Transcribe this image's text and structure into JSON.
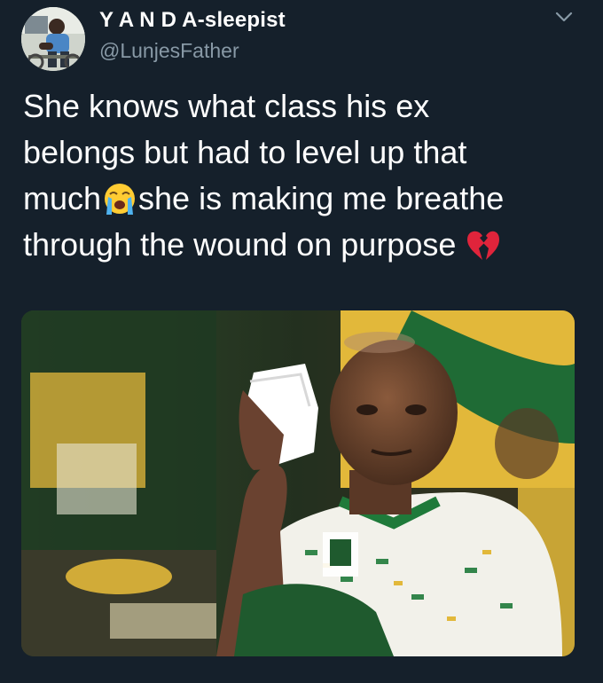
{
  "tweet": {
    "author": {
      "display_name": "Y A N D A-sleepist",
      "handle": "@LunjesFather",
      "avatar_icon": "profile-photo"
    },
    "menu_icon": "chevron-down-icon",
    "text": {
      "line1": "She knows what class his ex",
      "line2": "belongs but had to level up that",
      "line3_before_emoji": "much",
      "emoji1": "loudly-crying-face-emoji",
      "line3_after_emoji": "she is making me breathe",
      "line4": "through the wound on purpose",
      "emoji2": "broken-heart-emoji"
    },
    "media": {
      "type": "photo",
      "icon": "tweet-photo"
    },
    "colors": {
      "background": "#15202b",
      "text": "#ffffff",
      "secondary_text": "#8899a6"
    }
  }
}
